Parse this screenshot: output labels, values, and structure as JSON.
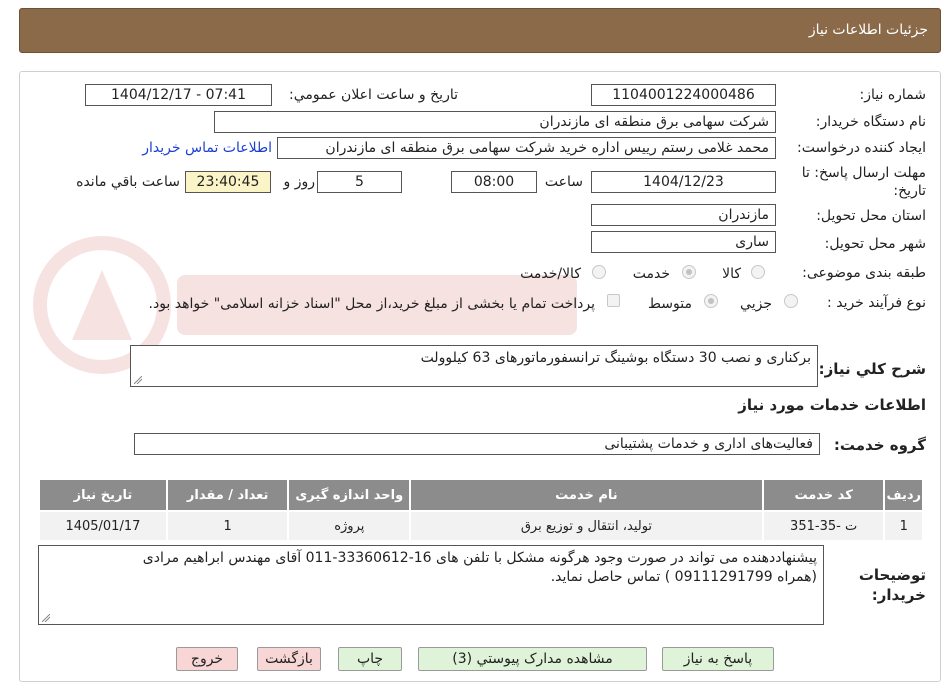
{
  "header": {
    "title": "جزئیات اطلاعات نیاز"
  },
  "labels": {
    "need_number": "شماره نیاز:",
    "announce_datetime": "تاریخ و ساعت اعلان عمومي:",
    "buyer_org": "نام دستگاه خریدار:",
    "requester": "ایجاد کننده درخواست:",
    "deadline": "مهلت ارسال پاسخ: تا",
    "deadline_date_word": "تاریخ:",
    "hour": "ساعت",
    "days_and": "روز و",
    "hours_left": "ساعت باقي مانده",
    "province": "استان محل تحویل:",
    "city": "شهر محل تحویل:",
    "subject_class": "طبقه بندی موضوعی:",
    "purchase_type": "نوع فرآیند خرید :",
    "general_desc": "شرح کلي نیاز:",
    "services_info": "اطلاعات خدمات مورد نیاز",
    "service_group": "گروه خدمت:",
    "buyer_notes_1": "توضیحات",
    "buyer_notes_2": "خریدار:"
  },
  "fields": {
    "need_number": "1104001224000486",
    "announce_datetime": "1404/12/17 - 07:41",
    "buyer_org": "شرکت سهامی برق منطقه ای مازندران",
    "requester": "محمد غلامی رستم رییس اداره خرید شرکت سهامی برق منطقه ای مازندران",
    "contact_link": "اطلاعات تماس خریدار",
    "deadline_date": "1404/12/23",
    "deadline_time": "08:00",
    "days": "5",
    "remaining": "23:40:45",
    "province": "مازندران",
    "city": "ساری",
    "general_desc": "برکناری و نصب 30 دستگاه بوشینگ ترانسفورماتورهای 63 کیلوولت",
    "service_group": "فعالیت‌های اداری و خدمات پشتیبانی",
    "buyer_notes_line1": "پیشنهاددهنده می تواند در صورت وجود هرگونه مشکل با تلفن های 16-33360612-011 آقای مهندس ابراهیم مرادی",
    "buyer_notes_line2": "(همراه  09111291799 ) تماس حاصل نماید."
  },
  "subject_options": [
    "کالا",
    "خدمت",
    "کالا/خدمت"
  ],
  "purchase_options": [
    "جزيي",
    "متوسط"
  ],
  "payment_note": "پرداخت تمام یا بخشی از مبلغ خرید،از محل \"اسناد خزانه اسلامی\" خواهد بود.",
  "table": {
    "headers": [
      "ردیف",
      "کد خدمت",
      "نام خدمت",
      "واحد اندازه گیری",
      "تعداد / مقدار",
      "تاریخ نیاز"
    ],
    "rows": [
      [
        "1",
        "ت -35-351",
        "تولید، انتقال و توزیع برق",
        "پروژه",
        "1",
        "1405/01/17"
      ]
    ]
  },
  "buttons": {
    "reply": "پاسخ به نیاز",
    "view_docs": "مشاهده مدارک پیوستي (3)",
    "print": "چاپ",
    "back": "بازگشت",
    "exit": "خروج"
  },
  "colors": {
    "header_bg": "#8a6a48",
    "table_header_bg": "#8c8c8c",
    "link": "#1a3fd4"
  }
}
